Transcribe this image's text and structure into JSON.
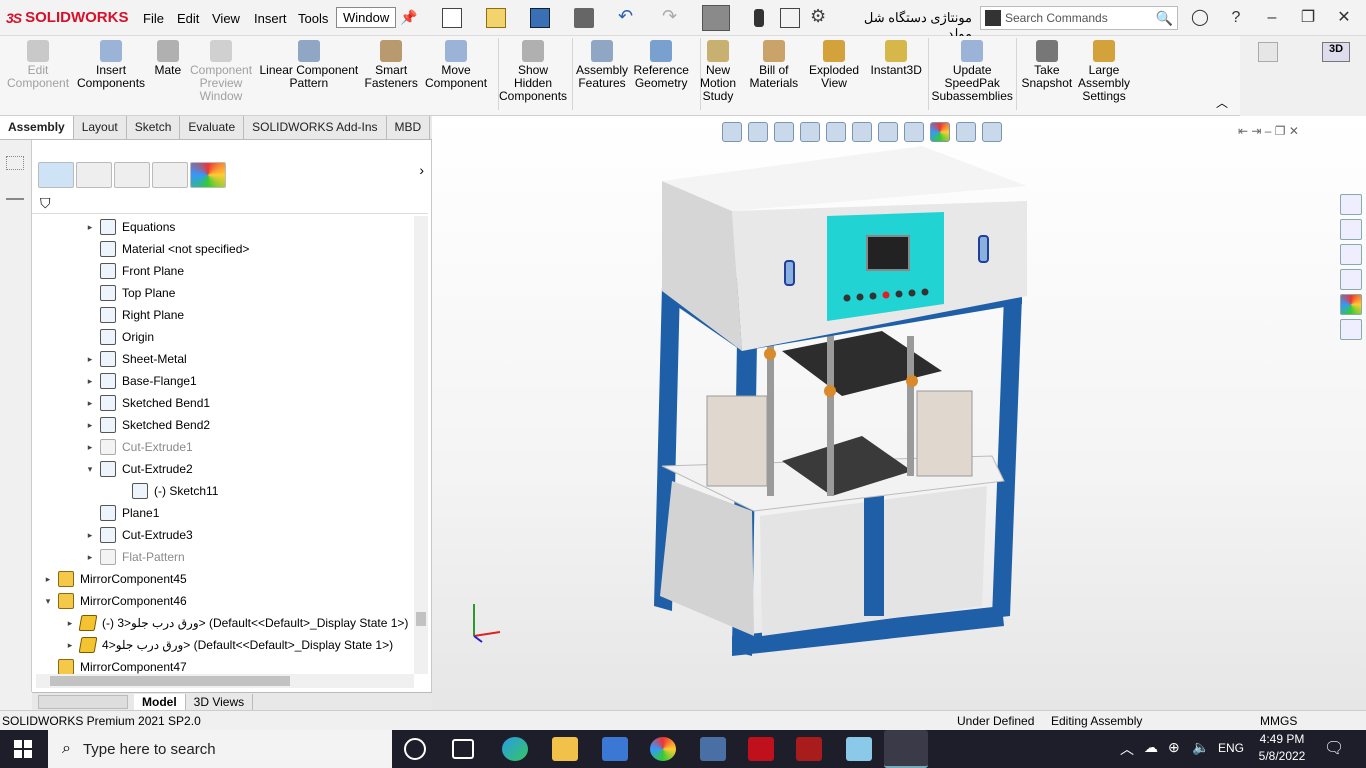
{
  "app": {
    "brand": "SOLIDWORKS",
    "doc_title": "مونتاژی دستگاه شل مولد",
    "search_placeholder": "Search Commands"
  },
  "menu": [
    "File",
    "Edit",
    "View",
    "Insert",
    "Tools",
    "Window"
  ],
  "commands": [
    {
      "label": "Edit\nComponent",
      "disabled": true
    },
    {
      "label": "Insert\nComponents",
      "disabled": false
    },
    {
      "label": "Mate",
      "disabled": false
    },
    {
      "label": "Component\nPreview\nWindow",
      "disabled": true
    },
    {
      "label": "Linear Component\nPattern",
      "disabled": false
    },
    {
      "label": "Smart\nFasteners",
      "disabled": false
    },
    {
      "label": "Move\nComponent",
      "disabled": false
    },
    {
      "label": "Show\nHidden\nComponents",
      "disabled": false
    },
    {
      "label": "Assembly\nFeatures",
      "disabled": false
    },
    {
      "label": "Reference\nGeometry",
      "disabled": false
    },
    {
      "label": "New\nMotion\nStudy",
      "disabled": false
    },
    {
      "label": "Bill of\nMaterials",
      "disabled": false
    },
    {
      "label": "Exploded\nView",
      "disabled": false
    },
    {
      "label": "Instant3D",
      "disabled": false
    },
    {
      "label": "Update\nSpeedPak\nSubassemblies",
      "disabled": false
    },
    {
      "label": "Take\nSnapshot",
      "disabled": false
    },
    {
      "label": "Large\nAssembly\nSettings",
      "disabled": false
    }
  ],
  "tabs": [
    "Assembly",
    "Layout",
    "Sketch",
    "Evaluate",
    "SOLIDWORKS Add-Ins",
    "MBD"
  ],
  "tree": [
    {
      "label": "Equations",
      "gray": false,
      "exp": "▸",
      "indent": 1
    },
    {
      "label": "Material <not specified>",
      "gray": false,
      "exp": "",
      "indent": 1
    },
    {
      "label": "Front Plane",
      "gray": false,
      "exp": "",
      "indent": 1
    },
    {
      "label": "Top Plane",
      "gray": false,
      "exp": "",
      "indent": 1
    },
    {
      "label": "Right Plane",
      "gray": false,
      "exp": "",
      "indent": 1
    },
    {
      "label": "Origin",
      "gray": false,
      "exp": "",
      "indent": 1
    },
    {
      "label": "Sheet-Metal",
      "gray": false,
      "exp": "▸",
      "indent": 1
    },
    {
      "label": "Base-Flange1",
      "gray": false,
      "exp": "▸",
      "indent": 1
    },
    {
      "label": "Sketched Bend1",
      "gray": false,
      "exp": "▸",
      "indent": 1
    },
    {
      "label": "Sketched Bend2",
      "gray": false,
      "exp": "▸",
      "indent": 1
    },
    {
      "label": "Cut-Extrude1",
      "gray": true,
      "exp": "▸",
      "indent": 1
    },
    {
      "label": "Cut-Extrude2",
      "gray": false,
      "exp": "▾",
      "indent": 1
    },
    {
      "label": "(-) Sketch11",
      "gray": false,
      "exp": "",
      "indent": 2
    },
    {
      "label": "Plane1",
      "gray": false,
      "exp": "",
      "indent": 1
    },
    {
      "label": "Cut-Extrude3",
      "gray": false,
      "exp": "▸",
      "indent": 1
    },
    {
      "label": "Flat-Pattern",
      "gray": true,
      "exp": "▸",
      "indent": 1
    },
    {
      "label": "MirrorComponent45",
      "gray": false,
      "exp": "▸",
      "indent": 0,
      "asm": true
    },
    {
      "label": "MirrorComponent46",
      "gray": false,
      "exp": "▾",
      "indent": 0,
      "asm": true
    },
    {
      "label": "(-) ورق درب جلو<3> (Default<<Default>_Display State 1>)",
      "gray": false,
      "exp": "▸",
      "indent": 0.5,
      "part": true
    },
    {
      "label": "ورق درب جلو<4> (Default<<Default>_Display State 1>)",
      "gray": false,
      "exp": "▸",
      "indent": 0.5,
      "part": true
    },
    {
      "label": "MirrorComponent47",
      "gray": false,
      "exp": "",
      "indent": 0,
      "asm": true
    }
  ],
  "bottom_tabs": [
    "Model",
    "3D Views"
  ],
  "status": {
    "product": "SOLIDWORKS Premium 2021 SP2.0",
    "defined": "Under Defined",
    "mode": "Editing Assembly",
    "units": "MMGS"
  },
  "taskbar": {
    "search": "Type here to search",
    "lang": "ENG",
    "time": "4:49 PM",
    "date": "5/8/2022"
  },
  "colors": {
    "accent": "#d8102a",
    "frame_blue": "#1f5fa8",
    "cabinet": "#dcdcdc",
    "panel_cyan": "#22d3d3"
  }
}
